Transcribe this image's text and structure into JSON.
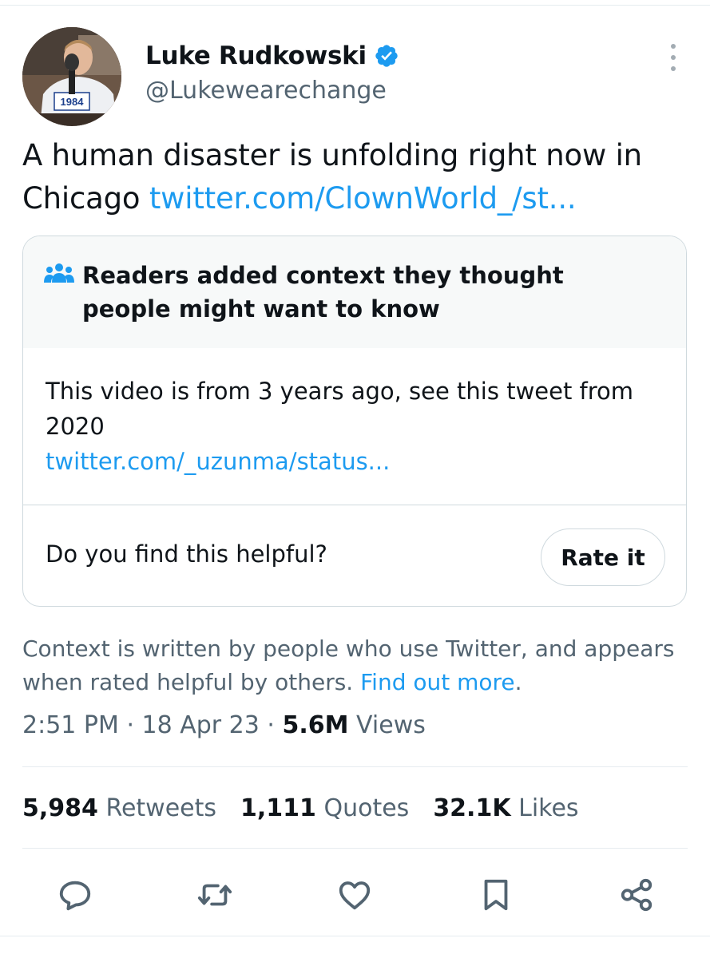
{
  "author": {
    "name": "Luke Rudkowski",
    "handle": "@Lukewearechange",
    "verified": true,
    "avatar_shirt_text": "1984"
  },
  "tweet": {
    "text": "A human disaster is unfolding right now in Chicago",
    "link_text": "twitter.com/ClownWorld_/st..."
  },
  "community_note": {
    "title": "Readers added context they thought people might want to know",
    "body": "This video is from 3 years ago, see this tweet from 2020",
    "link_text": "twitter.com/_uzunma/status...",
    "helpful_question": "Do you find this helpful?",
    "rate_button_label": "Rate it"
  },
  "context_disclaimer": {
    "text": "Context is written by people who use Twitter, and appears when rated helpful by others.",
    "link_text": "Find out more",
    "trailing": "."
  },
  "meta": {
    "time": "2:51 PM",
    "date": "18 Apr 23",
    "separator": "·",
    "views_count": "5.6M",
    "views_label": "Views"
  },
  "stats": [
    {
      "count": "5,984",
      "label": "Retweets"
    },
    {
      "count": "1,111",
      "label": "Quotes"
    },
    {
      "count": "32.1K",
      "label": "Likes"
    }
  ],
  "actions": [
    "reply-icon",
    "retweet-icon",
    "like-icon",
    "bookmark-icon",
    "share-icon"
  ],
  "colors": {
    "accent": "#1d9bf0",
    "text": "#0f1419",
    "secondary": "#536471",
    "border": "#cfd9de"
  }
}
